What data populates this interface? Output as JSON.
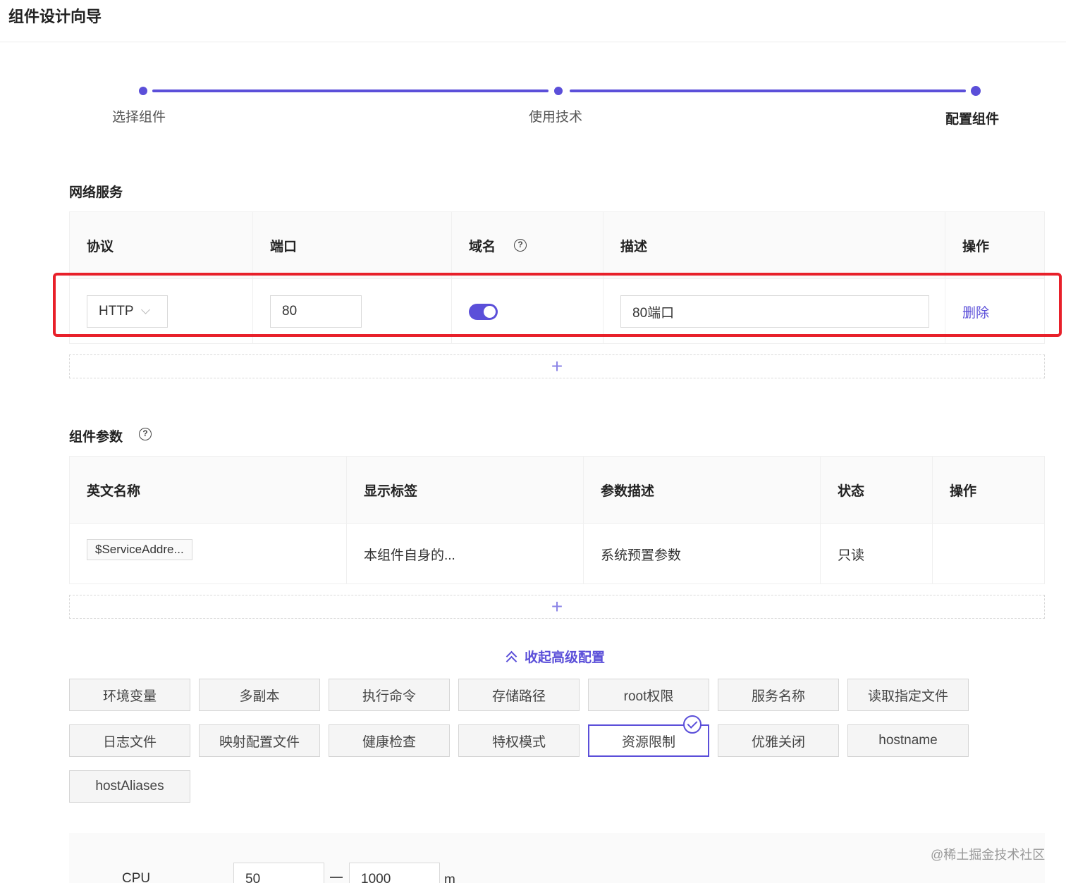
{
  "page": {
    "title": "组件设计向导"
  },
  "stepper": {
    "steps": [
      {
        "label": "选择组件"
      },
      {
        "label": "使用技术"
      },
      {
        "label": "配置组件"
      }
    ],
    "accent_color": "#5b4fd9"
  },
  "network": {
    "title": "网络服务",
    "headers": {
      "protocol": "协议",
      "port": "端口",
      "domain": "域名",
      "desc": "描述",
      "action": "操作"
    },
    "row": {
      "protocol": "HTTP",
      "port": "80",
      "domain_enabled": true,
      "desc": "80端口",
      "action": "删除"
    },
    "add_icon": "+"
  },
  "params": {
    "title": "组件参数",
    "headers": {
      "name": "英文名称",
      "label": "显示标签",
      "desc": "参数描述",
      "status": "状态",
      "action": "操作"
    },
    "rows": [
      {
        "name": "$ServiceAddre...",
        "label": "本组件自身的...",
        "desc": "系统预置参数",
        "status": "只读",
        "action": ""
      }
    ],
    "add_icon": "+"
  },
  "advanced": {
    "toggle_label": "收起高级配置",
    "options": [
      {
        "label": "环境变量",
        "selected": false
      },
      {
        "label": "多副本",
        "selected": false
      },
      {
        "label": "执行命令",
        "selected": false
      },
      {
        "label": "存储路径",
        "selected": false
      },
      {
        "label": "root权限",
        "selected": false
      },
      {
        "label": "服务名称",
        "selected": false
      },
      {
        "label": "读取指定文件",
        "selected": false
      },
      {
        "label": "日志文件",
        "selected": false
      },
      {
        "label": "映射配置文件",
        "selected": false
      },
      {
        "label": "健康检查",
        "selected": false
      },
      {
        "label": "特权模式",
        "selected": false
      },
      {
        "label": "资源限制",
        "selected": true
      },
      {
        "label": "优雅关闭",
        "selected": false
      },
      {
        "label": "hostname",
        "selected": false
      },
      {
        "label": "hostAliases",
        "selected": false
      }
    ]
  },
  "resources": {
    "cpu_label": "CPU",
    "cpu_min": "50",
    "cpu_max": "1000",
    "cpu_unit": "m"
  },
  "watermark": "@稀土掘金技术社区"
}
